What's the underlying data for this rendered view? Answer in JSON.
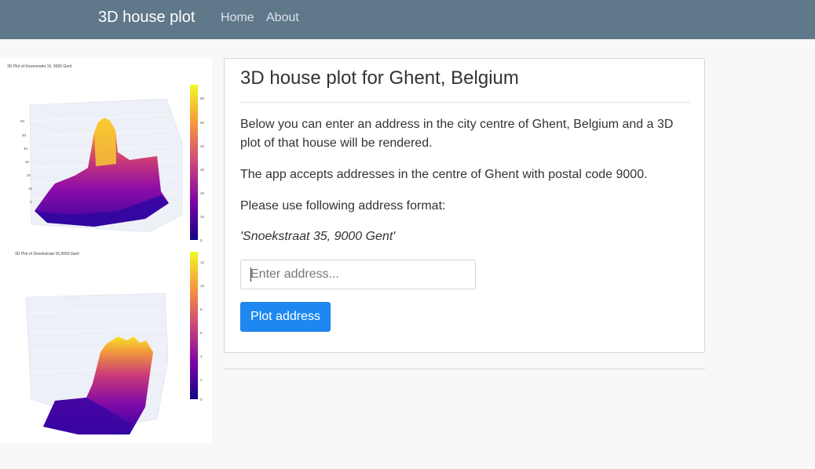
{
  "navbar": {
    "brand": "3D house plot",
    "links": [
      {
        "label": "Home"
      },
      {
        "label": "About"
      }
    ],
    "background": "#5f788a"
  },
  "plots": [
    {
      "title": "3D Plot of Korenmarkt 15, 9000 Gent",
      "colorbar_ticks": [
        "60",
        "50",
        "40",
        "30",
        "20",
        "10",
        "0"
      ],
      "z_ticks": [
        "60",
        "50",
        "40",
        "30",
        "20",
        "10",
        "0"
      ],
      "colorscale": "plasma"
    },
    {
      "title": "3D Plot of Snoekstraat 35,9000 Gent",
      "colorbar_ticks": [
        "12",
        "10",
        "8",
        "6",
        "4",
        "2",
        "0"
      ],
      "colorscale": "plasma"
    }
  ],
  "card": {
    "title": "3D house plot for Ghent, Belgium",
    "paragraphs": [
      "Below you can enter an address in the city centre of Ghent, Belgium and a 3D plot of that house will be rendered.",
      "The app accepts addresses in the centre of Ghent with postal code 9000.",
      "Please use following address format:",
      "'Snoekstraat 35, 9000 Gent'"
    ],
    "input": {
      "placeholder": "Enter address...",
      "value": ""
    },
    "button": {
      "label": "Plot address",
      "color": "#1e88f0"
    }
  }
}
